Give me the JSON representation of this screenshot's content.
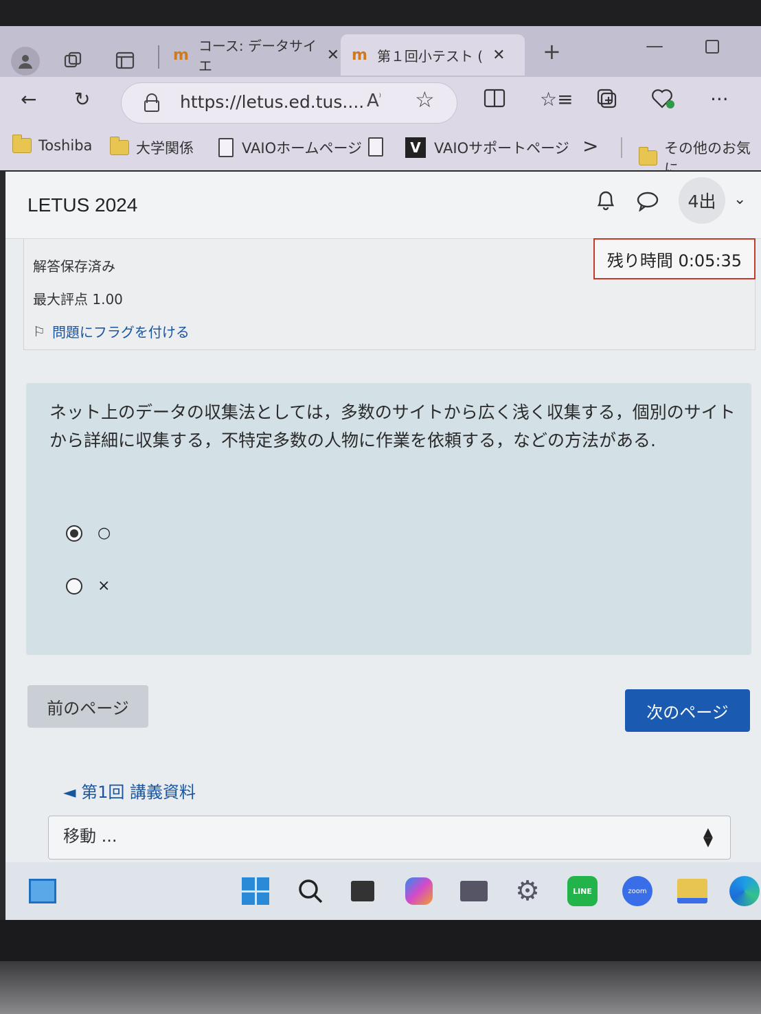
{
  "browser": {
    "tabs": [
      {
        "label": "コース: データサイエ",
        "close": "✕",
        "active": false
      },
      {
        "label": "第１回小テスト (",
        "close": "✕",
        "active": true
      }
    ],
    "new_tab": "+",
    "address": {
      "url": "https://letus.ed.tus...."
    },
    "bookmarks": [
      {
        "label": "Toshiba",
        "icon": "folder-icon"
      },
      {
        "label": "大学関係",
        "icon": "folder-icon"
      },
      {
        "label": "VAIOホームページ",
        "icon": "page-icon"
      },
      {
        "label": "",
        "icon": "page-icon"
      },
      {
        "label": "VAIOサポートページ",
        "icon": "vaio-icon"
      },
      {
        "label": "その他のお気に",
        "icon": "folder-icon"
      }
    ],
    "vaio_glyph": "V",
    "more_bookmarks": ">"
  },
  "site": {
    "brand": "LETUS 2024",
    "user_initials": "4出"
  },
  "question_info": {
    "status": "解答保存済み",
    "max_score": "最大評点 1.00",
    "flag_label": "問題にフラグを付ける"
  },
  "timer": {
    "text": "残り時間 0:05:35"
  },
  "question": {
    "text": "ネット上のデータの収集法としては，多数のサイトから広く浅く収集する，個別のサイトから詳細に収集する，不特定多数の人物に作業を依頼する，などの方法がある.",
    "options": [
      {
        "label": "○",
        "checked": true
      },
      {
        "label": "×",
        "checked": false
      }
    ]
  },
  "navigation": {
    "prev_button": "前のページ",
    "next_button": "次のページ",
    "prev_activity": "◄ 第1回 講義資料",
    "jump_select": "移動 ..."
  },
  "taskbar": {
    "apps": [
      "widgets-icon",
      "start-icon",
      "search-icon",
      "task-view-icon",
      "copilot-icon",
      "laptop-icon",
      "settings-icon",
      "line-icon",
      "zoom-icon",
      "file-explorer-icon",
      "edge-icon"
    ],
    "line_label": "LINE",
    "zoom_label": "zoom"
  },
  "colors": {
    "accent": "#1a5ab0",
    "link": "#1a56a0",
    "timer_border": "#c0392b",
    "question_bg": "#d3e0e6"
  }
}
